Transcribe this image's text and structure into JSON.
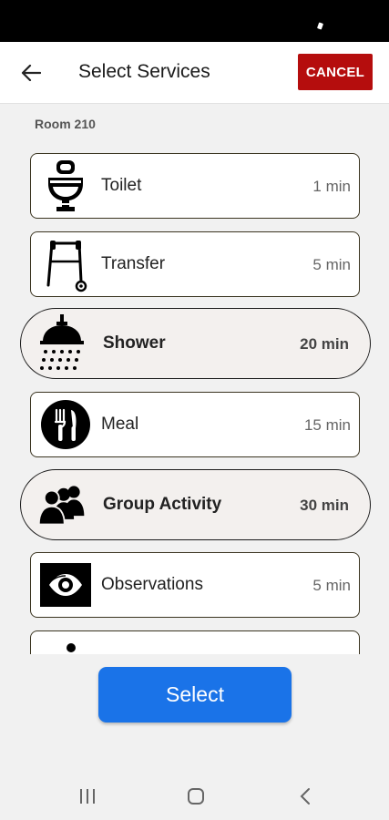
{
  "header": {
    "title": "Select Services",
    "cancel_label": "CANCEL"
  },
  "room": {
    "label": "Room 210"
  },
  "services": [
    {
      "name": "Toilet",
      "duration": "1 min",
      "icon": "toilet-icon",
      "selected": false
    },
    {
      "name": "Transfer",
      "duration": "5 min",
      "icon": "walker-icon",
      "selected": false
    },
    {
      "name": "Shower",
      "duration": "20 min",
      "icon": "shower-icon",
      "selected": true
    },
    {
      "name": "Meal",
      "duration": "15 min",
      "icon": "fork-knife-icon",
      "selected": false
    },
    {
      "name": "Group Activity",
      "duration": "30 min",
      "icon": "group-icon",
      "selected": true
    },
    {
      "name": "Observations",
      "duration": "5 min",
      "icon": "eye-icon",
      "selected": false
    },
    {
      "name": "",
      "duration": "",
      "icon": "person-icon",
      "selected": false
    }
  ],
  "footer": {
    "select_label": "Select"
  },
  "nav": {
    "buttons": [
      "recents-icon",
      "home-icon",
      "back-icon"
    ]
  },
  "colors": {
    "accent": "#1a73e8",
    "cancel": "#b50d0d",
    "selected_bg": "#f3f0ee"
  }
}
